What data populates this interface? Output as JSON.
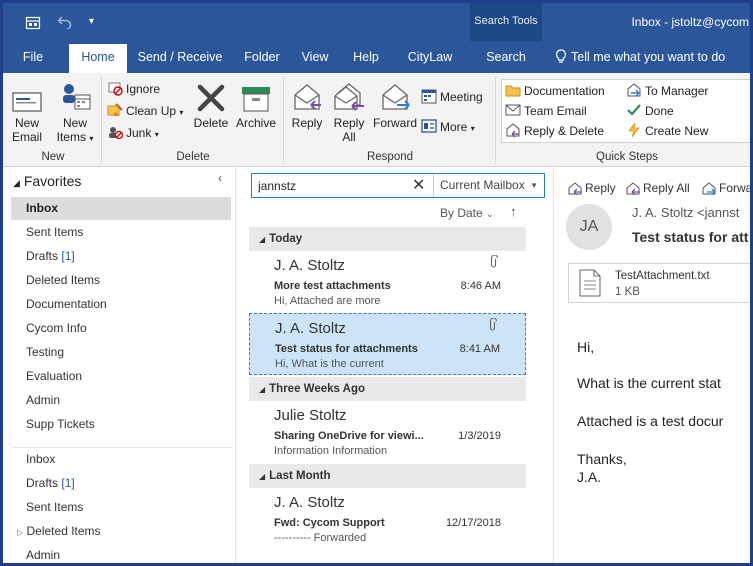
{
  "titlebar": {
    "search_tools_label": "Search Tools",
    "window_title": "Inbox - jstoltz@cycom"
  },
  "tabs": [
    {
      "label": "File"
    },
    {
      "label": "Home"
    },
    {
      "label": "Send / Receive"
    },
    {
      "label": "Folder"
    },
    {
      "label": "View"
    },
    {
      "label": "Help"
    },
    {
      "label": "CityLaw"
    },
    {
      "label": "Search"
    }
  ],
  "tell_me": "Tell me what you want to do",
  "ribbon": {
    "new_group": {
      "label": "New",
      "new_email": "New\nEmail",
      "new_items": "New\nItems"
    },
    "delete_group": {
      "label": "Delete",
      "ignore": "Ignore",
      "clean_up": "Clean Up",
      "junk": "Junk",
      "delete": "Delete",
      "archive": "Archive"
    },
    "respond_group": {
      "label": "Respond",
      "reply": "Reply",
      "reply_all": "Reply\nAll",
      "forward": "Forward",
      "meeting": "Meeting",
      "more": "More"
    },
    "quicksteps_group": {
      "label": "Quick Steps",
      "documentation": "Documentation",
      "team_email": "Team Email",
      "reply_delete": "Reply & Delete",
      "to_manager": "To Manager",
      "done": "Done",
      "create_new": "Create New"
    }
  },
  "favorites": {
    "header": "Favorites",
    "items": [
      {
        "label": "Inbox",
        "count": ""
      },
      {
        "label": "Sent Items",
        "count": ""
      },
      {
        "label": "Drafts",
        "count": "[1]"
      },
      {
        "label": "Deleted Items",
        "count": ""
      },
      {
        "label": "Documentation",
        "count": ""
      },
      {
        "label": "Cycom Info",
        "count": ""
      },
      {
        "label": "Testing",
        "count": ""
      },
      {
        "label": "Evaluation",
        "count": ""
      },
      {
        "label": "Admin",
        "count": ""
      },
      {
        "label": "Supp Tickets",
        "count": ""
      }
    ]
  },
  "mailbox_folders": [
    {
      "label": "Inbox",
      "count": ""
    },
    {
      "label": "Drafts",
      "count": "[1]"
    },
    {
      "label": "Sent Items",
      "count": ""
    },
    {
      "label": "Deleted Items",
      "count": ""
    },
    {
      "label": "Admin",
      "count": ""
    }
  ],
  "search": {
    "value": "jannstz",
    "scope": "Current Mailbox"
  },
  "sort": {
    "label": "By Date",
    "direction_icon": "arrow-up-icon"
  },
  "groups": [
    {
      "label": "Today"
    },
    {
      "label": "Three Weeks Ago"
    },
    {
      "label": "Last Month"
    }
  ],
  "messages": [
    {
      "sender": "J. A. Stoltz",
      "subject": "More test attachments",
      "preview": "Hi,  Attached are more",
      "time": "8:46 AM",
      "attachment": true
    },
    {
      "sender": "J. A. Stoltz",
      "subject": "Test status for attachments",
      "preview": "Hi,  What is the current",
      "time": "8:41 AM",
      "attachment": true
    },
    {
      "sender": "Julie Stoltz",
      "subject": "Sharing OneDrive for viewi...",
      "preview": "Information  Information",
      "time": "1/3/2019",
      "attachment": false
    },
    {
      "sender": "J. A. Stoltz",
      "subject": "Fwd: Cycom Support",
      "preview": "---------- Forwarded",
      "time": "12/17/2018",
      "attachment": false
    }
  ],
  "reading": {
    "actions": {
      "reply": "Reply",
      "reply_all": "Reply All",
      "forward": "Forwa"
    },
    "avatar_initials": "JA",
    "from": "J. A. Stoltz <jannst",
    "subject": "Test status for att",
    "attachment": {
      "name": "TestAttachment.txt",
      "size": "1 KB"
    },
    "body": [
      "Hi,",
      "What is the current stat",
      "Attached is a test docur",
      "Thanks,",
      "J.A."
    ]
  },
  "colors": {
    "brand": "#2b579a",
    "selection": "#cce4f7",
    "frame": "#1f3f8a"
  }
}
